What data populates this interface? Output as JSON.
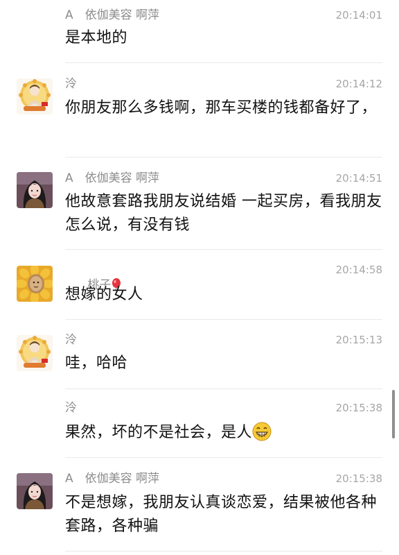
{
  "messages": [
    {
      "sender": "A　依伽美容 啊萍",
      "time": "20:14:01",
      "text": "是本地的",
      "avatar": "none"
    },
    {
      "sender": "泠",
      "time": "20:14:12",
      "text": "你朋友那么多钱啊，那车买楼的钱都备好了，",
      "avatar": "buddha-icon"
    },
    {
      "sender": "A　依伽美容 啊萍",
      "time": "20:14:51",
      "text": "他故意套路我朋友说结婚 一起买房，看我朋友怎么说，有没有钱",
      "avatar": "girl-photo"
    },
    {
      "sender": "桃子",
      "time": "20:14:58",
      "text": "想嫁的女人",
      "avatar": "sunflower-icon",
      "sender_emoji": "balloon-emoji-icon"
    },
    {
      "sender": "泠",
      "time": "20:15:13",
      "text": "哇，哈哈",
      "avatar": "buddha-icon"
    },
    {
      "sender": "泠",
      "time": "20:15:38",
      "text": "果然，坏的不是社会，是人",
      "avatar": "none",
      "trailing_emoji": "grinning-emoji-icon"
    },
    {
      "sender": "A　依伽美容 啊萍",
      "time": "20:15:38",
      "text": "不是想嫁，我朋友认真谈恋爱，结果被他各种套路，各种骗",
      "avatar": "girl-photo"
    }
  ],
  "colors": {
    "background": "#ffffff",
    "sender_name": "#8c8c8c",
    "timestamp": "#a6a6a6",
    "message_text": "#111111",
    "divider": "#e9e9e9"
  }
}
